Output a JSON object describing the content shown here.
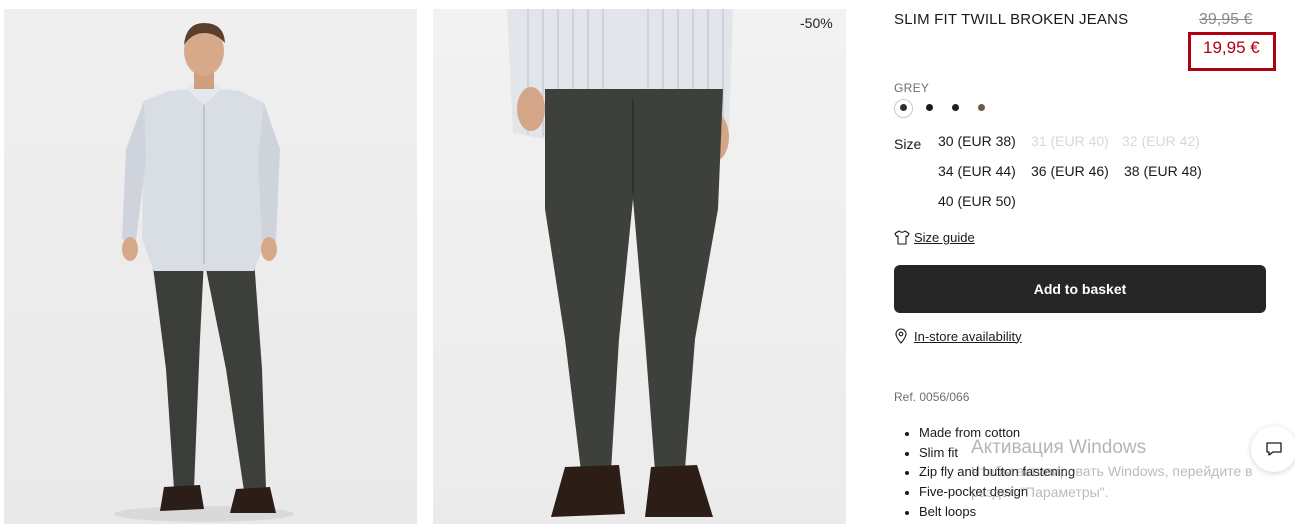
{
  "gallery": {
    "image_1_alt": "Model wearing slim fit twill broken jeans, full body",
    "image_2_alt": "Close-up of slim fit twill broken jeans",
    "discount_badge": "-50%"
  },
  "product": {
    "title": "SLIM FIT TWILL BROKEN JEANS",
    "old_price": "39,95 €",
    "new_price": "19,95 €",
    "color_name": "GREY",
    "colors": [
      {
        "name": "grey",
        "hex": "#2e2e2e",
        "selected": true
      },
      {
        "name": "black",
        "hex": "#1a1a1a",
        "selected": false
      },
      {
        "name": "navy",
        "hex": "#1c1f26",
        "selected": false
      },
      {
        "name": "khaki",
        "hex": "#6b5b45",
        "selected": false
      }
    ],
    "size_label": "Size",
    "sizes": [
      {
        "label": "30 (EUR 38)",
        "available": true
      },
      {
        "label": "31 (EUR 40)",
        "available": false
      },
      {
        "label": "32 (EUR 42)",
        "available": false
      },
      {
        "label": "34 (EUR 44)",
        "available": true
      },
      {
        "label": "36 (EUR 46)",
        "available": true
      },
      {
        "label": "38 (EUR 48)",
        "available": true
      },
      {
        "label": "40 (EUR 50)",
        "available": true
      }
    ],
    "size_guide": "Size guide",
    "add_to_basket": "Add to basket",
    "in_store": "In-store availability",
    "ref": "Ref. 0056/066",
    "features": [
      "Made from cotton",
      "Slim fit",
      "Zip fly and button fastening",
      "Five-pocket design",
      "Belt loops"
    ]
  },
  "overlay": {
    "watermark_title": "Активация Windows",
    "watermark_sub": "Чтобы активировать Windows, перейдите в раздел \"Параметры\"."
  },
  "icons": {
    "shirt": "tshirt-icon",
    "location": "location-pin-icon",
    "chat": "chat-icon"
  }
}
